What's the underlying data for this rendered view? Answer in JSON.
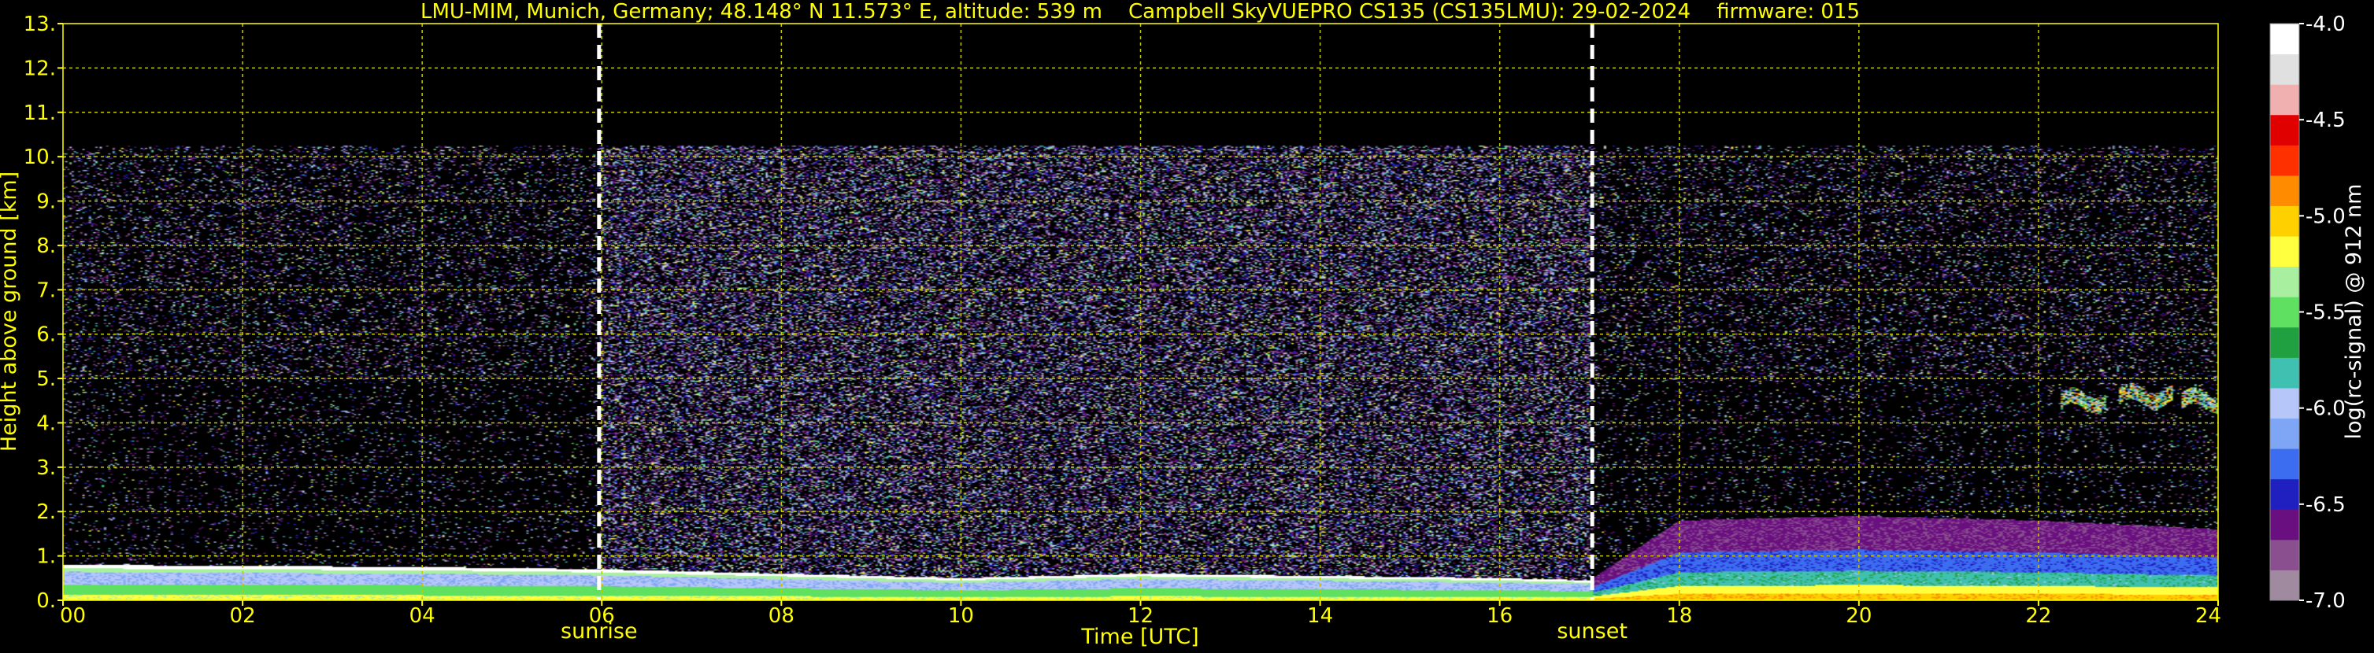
{
  "chart_data": {
    "type": "heatmap",
    "title": "LMU-MIM, Munich, Germany; 48.148° N 11.573° E, altitude: 539 m    Campbell SkyVUEPRO CS135 (CS135LMU): 29-02-2024    firmware: 015",
    "xlabel": "Time [UTC]",
    "ylabel": "Height above ground [km]",
    "xlim": [
      0,
      24
    ],
    "ylim": [
      0,
      13
    ],
    "x_ticks": [
      0,
      2,
      4,
      6,
      8,
      10,
      12,
      14,
      16,
      18,
      20,
      22,
      24
    ],
    "x_tick_labels": [
      "00",
      "02",
      "04",
      "06",
      "08",
      "10",
      "12",
      "14",
      "16",
      "18",
      "20",
      "22",
      "24"
    ],
    "y_ticks": [
      0,
      1,
      2,
      3,
      4,
      5,
      6,
      7,
      8,
      9,
      10,
      11,
      12,
      13
    ],
    "y_tick_labels": [
      "0.",
      "1.",
      "2.",
      "3.",
      "4.",
      "5.",
      "6.",
      "7.",
      "8.",
      "9.",
      "10.",
      "11.",
      "12.",
      "13."
    ],
    "grid": true,
    "markers": [
      {
        "label": "sunrise",
        "x": 5.97
      },
      {
        "label": "sunset",
        "x": 17.03
      }
    ],
    "noise_top_km": 10.25,
    "boundary_layer": [
      {
        "x": 0,
        "top": 0.8
      },
      {
        "x": 4,
        "top": 0.75
      },
      {
        "x": 6,
        "top": 0.7
      },
      {
        "x": 8,
        "top": 0.6
      },
      {
        "x": 10,
        "top": 0.5
      },
      {
        "x": 12,
        "top": 0.6
      },
      {
        "x": 14,
        "top": 0.55
      },
      {
        "x": 16,
        "top": 0.5
      },
      {
        "x": 17,
        "top": 0.45
      },
      {
        "x": 18,
        "top": 1.8
      },
      {
        "x": 20,
        "top": 1.9
      },
      {
        "x": 22,
        "top": 1.8
      },
      {
        "x": 24,
        "top": 1.6
      }
    ],
    "cloud_patches": [
      {
        "x_start": 22.25,
        "x_end": 22.75,
        "height": 4.5
      },
      {
        "x_start": 22.9,
        "x_end": 23.5,
        "height": 4.6
      },
      {
        "x_start": 23.6,
        "x_end": 24.0,
        "height": 4.5
      }
    ],
    "colorbar": {
      "label": "log(rc-signal) @ 912 nm",
      "range": [
        -7.0,
        -4.0
      ],
      "ticks": [
        -7.0,
        -6.5,
        -6.0,
        -5.5,
        -5.0,
        -4.5,
        -4.0
      ],
      "tick_labels": [
        "-7.0",
        "-6.5",
        "-6.0",
        "-5.5",
        "-5.0",
        "-4.5",
        "-4.0"
      ],
      "colors": [
        "#a08aa0",
        "#8a4f8f",
        "#6a0f80",
        "#2020c0",
        "#3c6cf0",
        "#7ea6f5",
        "#b6c6f8",
        "#40c0b0",
        "#20a040",
        "#60e060",
        "#a8f0a0",
        "#ffff40",
        "#ffd000",
        "#ff8c00",
        "#ff3000",
        "#e00000",
        "#f0b0b0",
        "#e0e0e0",
        "#ffffff"
      ]
    },
    "colors": {
      "text": "#ffff00",
      "grid": "#c8c800",
      "background": "#000000",
      "marker": "#ffffff",
      "colorbar_label": "#ffffff"
    }
  }
}
